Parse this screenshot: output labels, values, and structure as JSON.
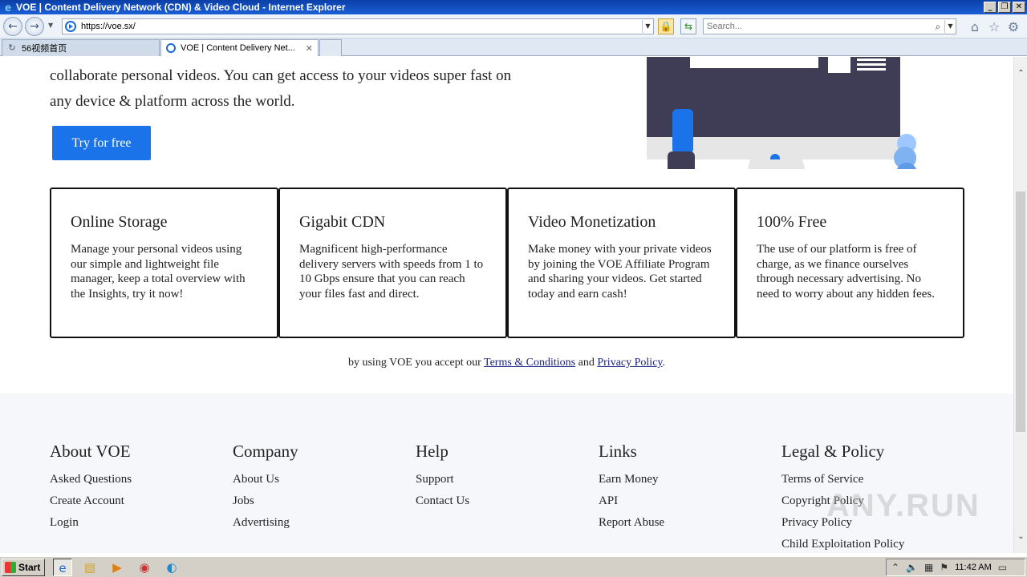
{
  "window": {
    "title": "VOE | Content Delivery Network (CDN) & Video Cloud - Internet Explorer",
    "btn_min": "_",
    "btn_restore": "❐",
    "btn_close": "✕"
  },
  "addressbar": {
    "url": "https://voe.sx/",
    "search_placeholder": "Search...",
    "back_icon": "←",
    "forward_icon": "→"
  },
  "tabs": [
    {
      "label": "56视频首页",
      "loading": true
    },
    {
      "label": "VOE | Content Delivery Net...",
      "close": "✕"
    }
  ],
  "hero": {
    "text": "collaborate personal videos. You can get access to your videos super fast on any device & platform across the world.",
    "cta_label": "Try for free"
  },
  "features": [
    {
      "title": "Online Storage",
      "text": "Manage your personal videos using our simple and lightweight file manager, keep a total overview with the Insights, try it now!"
    },
    {
      "title": "Gigabit CDN",
      "text": "Magnificent high-performance delivery servers with speeds from 1 to 10 Gbps ensure that you can reach your files fast and direct."
    },
    {
      "title": "Video Monetization",
      "text": "Make money with your private videos by joining the VOE Affiliate Program and sharing your videos. Get started today and earn cash!"
    },
    {
      "title": "100% Free",
      "text": "The use of our platform is free of charge, as we finance ourselves through necessary advertising. No need to worry about any hidden fees."
    }
  ],
  "terms": {
    "prefix": "by using VOE you accept our ",
    "terms_link": "Terms & Conditions",
    "middle": " and ",
    "privacy_link": "Privacy Policy",
    "suffix": "."
  },
  "footer": {
    "columns": [
      {
        "heading": "About VOE",
        "links": [
          "Asked Questions",
          "Create Account",
          "Login"
        ]
      },
      {
        "heading": "Company",
        "links": [
          "About Us",
          "Jobs",
          "Advertising"
        ]
      },
      {
        "heading": "Help",
        "links": [
          "Support",
          "Contact Us"
        ]
      },
      {
        "heading": "Links",
        "links": [
          "Earn Money",
          "API",
          "Report Abuse"
        ]
      },
      {
        "heading": "Legal & Policy",
        "links": [
          "Terms of Service",
          "Copyright Policy",
          "Privacy Policy",
          "Child Exploitation Policy"
        ]
      }
    ]
  },
  "watermark": "ANY.RUN",
  "taskbar": {
    "start_label": "Start",
    "clock": "11:42 AM"
  },
  "colors": {
    "accent": "#1a73e8",
    "footer_bg": "#f5f7fa",
    "link": "#1a237e"
  }
}
